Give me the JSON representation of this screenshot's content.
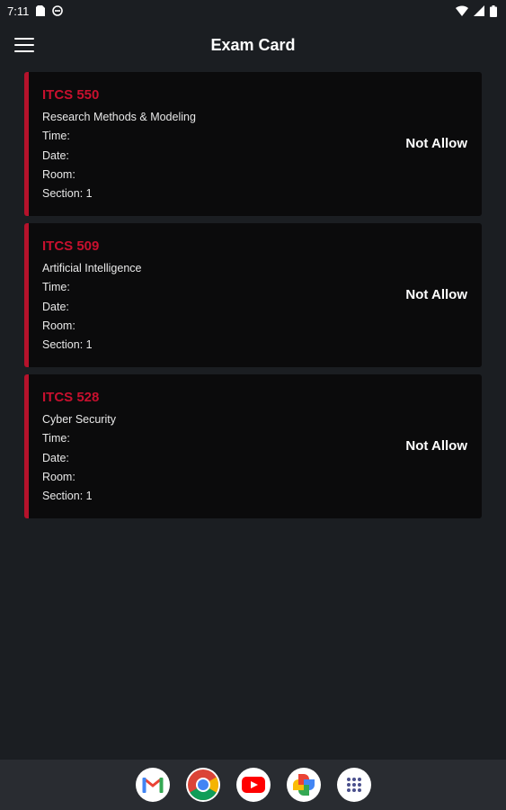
{
  "statusbar": {
    "time": "7:11"
  },
  "appbar": {
    "title": "Exam Card"
  },
  "cards": [
    {
      "code": "ITCS 550",
      "name": "Research Methods & Modeling",
      "time": "Time:",
      "date": "Date:",
      "room": "Room:",
      "section": "Section: 1",
      "status": "Not Allow"
    },
    {
      "code": "ITCS 509",
      "name": "Artificial Intelligence",
      "time": "Time:",
      "date": "Date:",
      "room": "Room:",
      "section": "Section: 1",
      "status": "Not Allow"
    },
    {
      "code": "ITCS 528",
      "name": "Cyber Security",
      "time": "Time:",
      "date": "Date:",
      "room": "Room:",
      "section": "Section: 1",
      "status": "Not Allow"
    }
  ],
  "dock": [
    "gmail-icon",
    "chrome-icon",
    "youtube-icon",
    "photos-icon",
    "app-drawer-icon"
  ],
  "colors": {
    "accent": "#c8102e",
    "background": "#1b1e22",
    "card": "#0b0b0c"
  }
}
